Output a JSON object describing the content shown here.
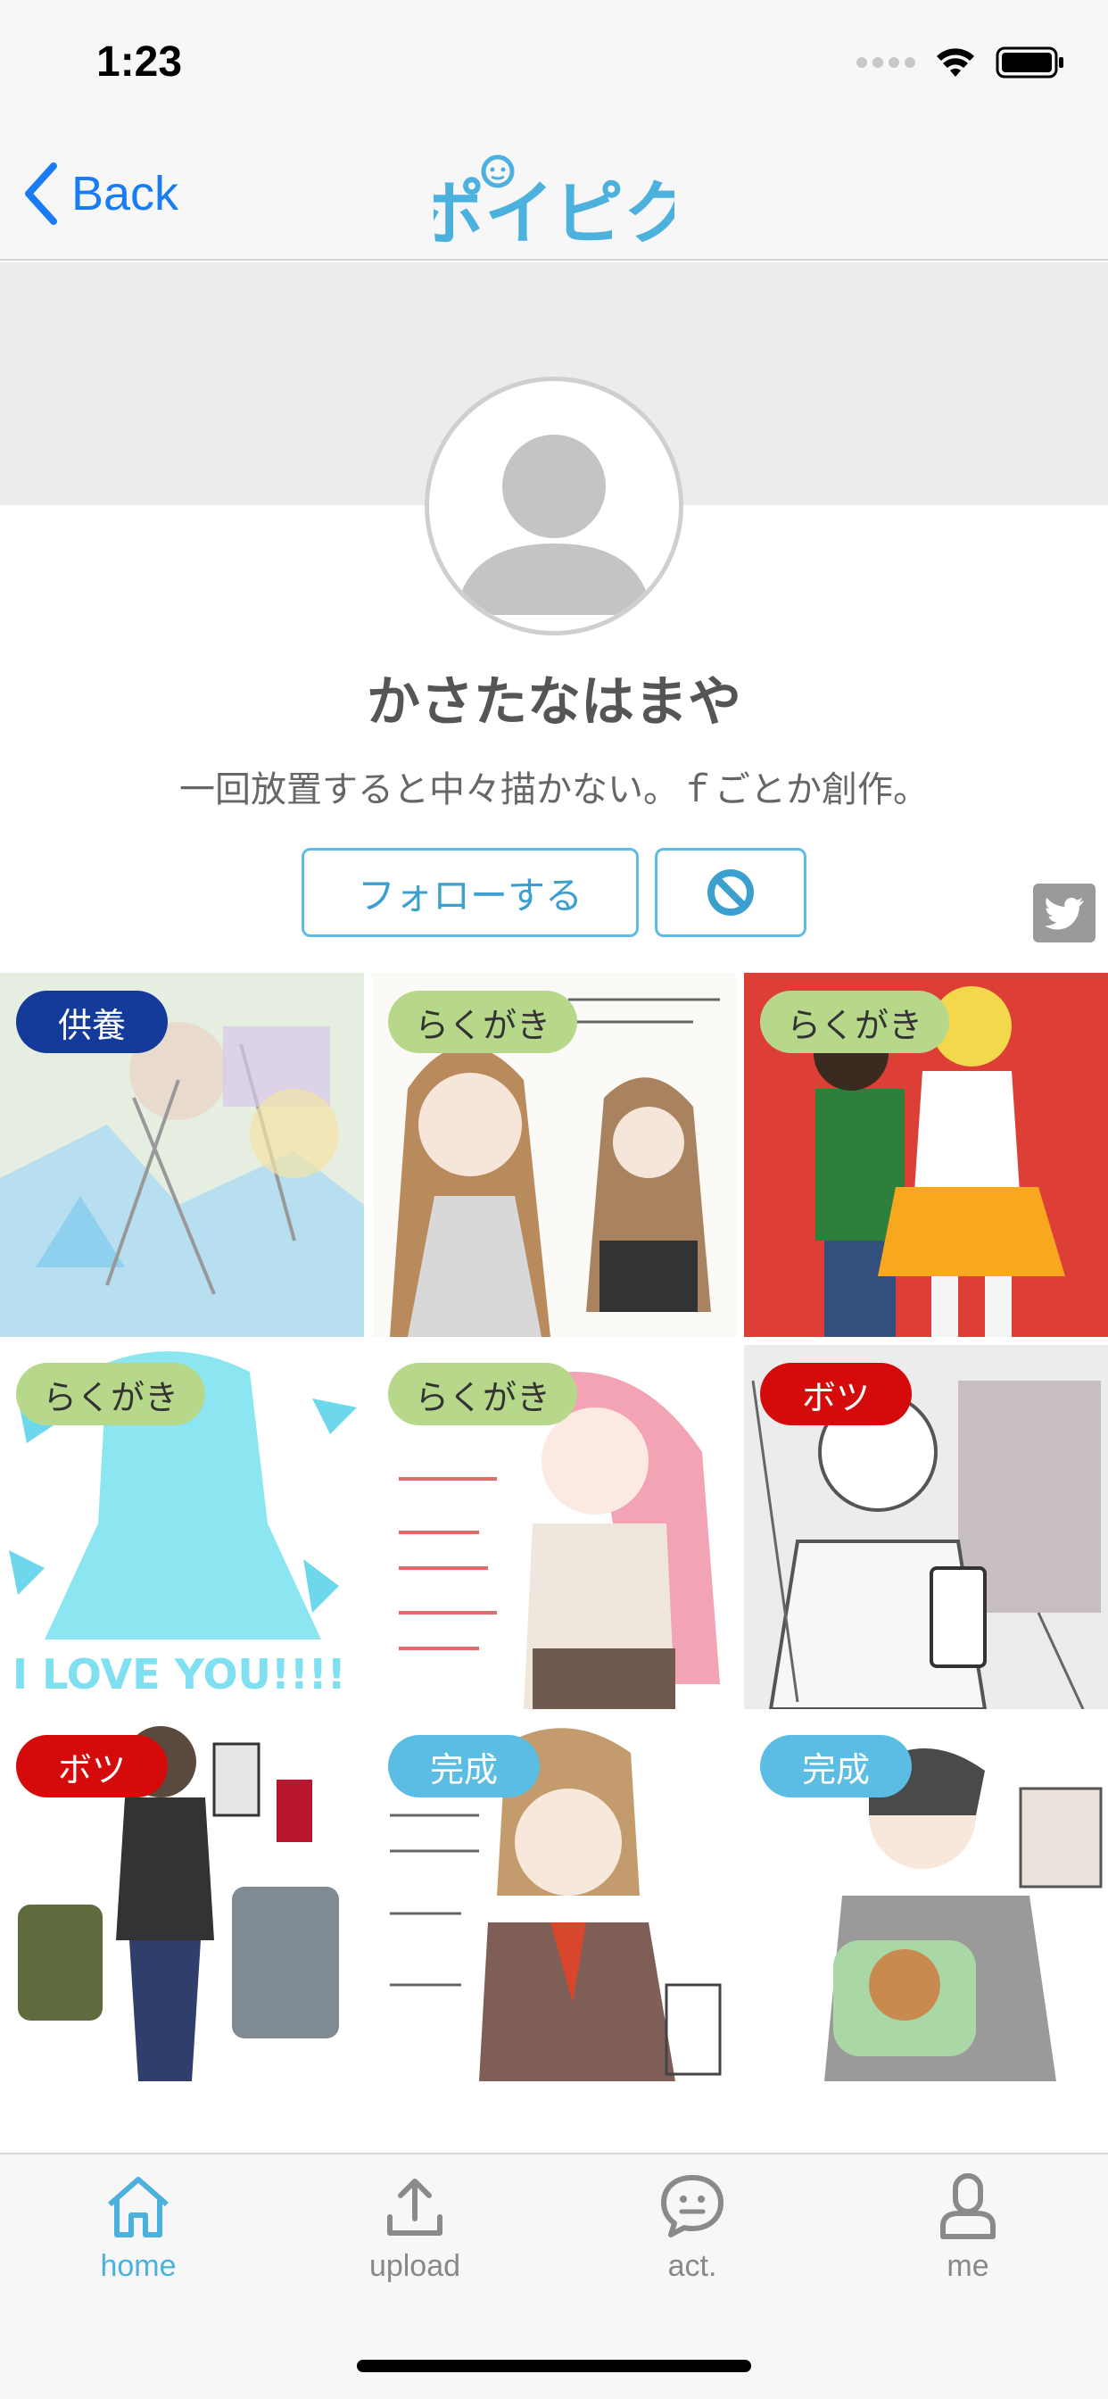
{
  "status_bar": {
    "time": "1:23"
  },
  "nav": {
    "back_label": "Back",
    "logo_text": "ポイピク"
  },
  "profile": {
    "name": "かさたなはまや",
    "bio": "一回放置すると中々描かない。ｆごとか創作。",
    "follow_label": "フォローする"
  },
  "posts": [
    {
      "tag": "供養",
      "tag_color": "#143a9a",
      "tag_text_color": "#ffffff"
    },
    {
      "tag": "らくがき",
      "tag_color": "#b7d88a",
      "tag_text_color": "#333333"
    },
    {
      "tag": "らくがき",
      "tag_color": "#b7d88a",
      "tag_text_color": "#333333"
    },
    {
      "tag": "らくがき",
      "tag_color": "#b7d88a",
      "tag_text_color": "#333333"
    },
    {
      "tag": "らくがき",
      "tag_color": "#b7d88a",
      "tag_text_color": "#333333"
    },
    {
      "tag": "ボツ",
      "tag_color": "#d50b0b",
      "tag_text_color": "#ffffff"
    },
    {
      "tag": "ボツ",
      "tag_color": "#d50b0b",
      "tag_text_color": "#ffffff"
    },
    {
      "tag": "完成",
      "tag_color": "#5bbde4",
      "tag_text_color": "#ffffff"
    },
    {
      "tag": "完成",
      "tag_color": "#5bbde4",
      "tag_text_color": "#ffffff"
    }
  ],
  "tabs": [
    {
      "label": "home",
      "icon": "home-icon",
      "active": true
    },
    {
      "label": "upload",
      "icon": "upload-icon",
      "active": false
    },
    {
      "label": "act.",
      "icon": "activity-icon",
      "active": false
    },
    {
      "label": "me",
      "icon": "person-icon",
      "active": false
    }
  ],
  "colors": {
    "accent": "#4db1de",
    "ios_blue": "#1a7cf5"
  }
}
